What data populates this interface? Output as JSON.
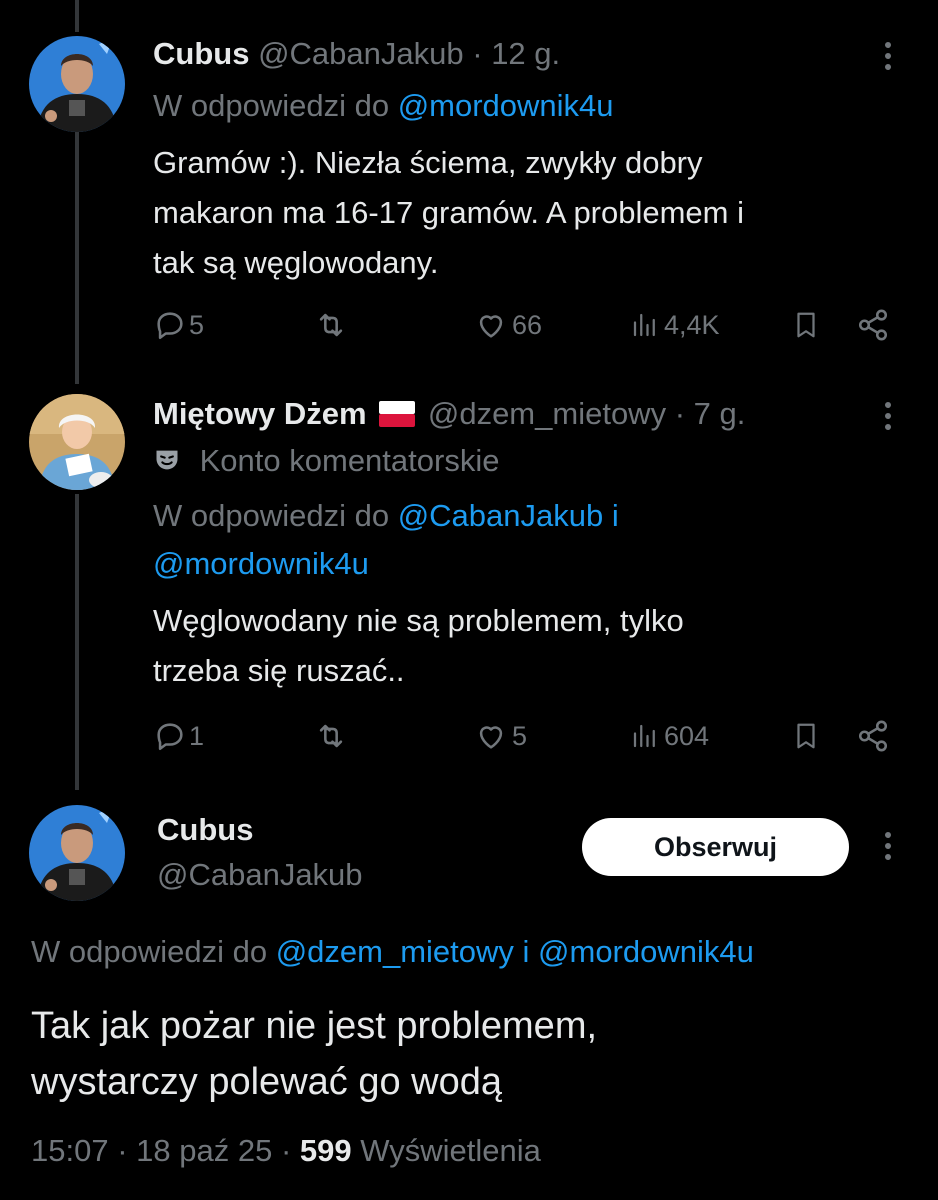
{
  "tweet1": {
    "display_name": "Cubus",
    "handle": "@CabanJakub",
    "sep": "·",
    "time": "12 g.",
    "reply_prefix": "W odpowiedzi do",
    "reply_to": "@mordownik4u",
    "text_lines": [
      "Gramów :). Niezła ściema, zwykły dobry",
      "makaron ma 16-17 gramów. A problemem i",
      "tak są węglowodany."
    ],
    "replies": "5",
    "likes": "66",
    "views": "4,4K"
  },
  "tweet2": {
    "display_name": "Miętowy Dżem",
    "handle": "@dzem_mietowy",
    "sep": "·",
    "time": "7 g.",
    "badge_text": "Konto komentatorskie",
    "reply_prefix": "W odpowiedzi do",
    "reply_to_1": "@CabanJakub i",
    "reply_to_2": "@mordownik4u",
    "text_lines": [
      "Węglowodany nie są problemem, tylko",
      "trzeba się ruszać.."
    ],
    "replies": "1",
    "likes": "5",
    "views": "604"
  },
  "main_tweet": {
    "display_name": "Cubus",
    "handle": "@CabanJakub",
    "follow_label": "Obserwuj",
    "reply_prefix": "W odpowiedzi do",
    "reply_to": "@dzem_mietowy i @mordownik4u",
    "text_lines": [
      "Tak jak pożar nie jest problemem,",
      "wystarczy polewać go wodą"
    ],
    "time": "15:07",
    "sep": "·",
    "date": "18 paź 25",
    "views_count": "599",
    "views_label": "Wyświetlenia"
  },
  "colors": {
    "background": "#000000",
    "text": "#e7e9ea",
    "muted": "#71767b",
    "link": "#1d9bf0"
  },
  "icons": [
    "reply-icon",
    "retweet-icon",
    "like-icon",
    "views-icon",
    "bookmark-icon",
    "share-icon",
    "more-icon",
    "theater-mask-icon",
    "poland-flag-icon"
  ]
}
